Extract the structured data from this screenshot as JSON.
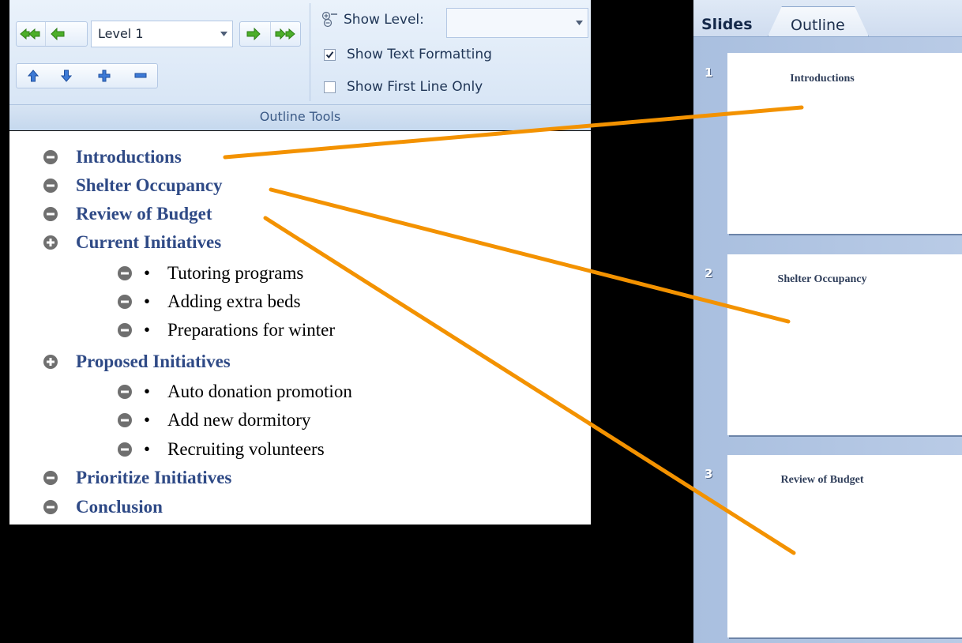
{
  "ribbon": {
    "level_value": "Level 1",
    "show_level_label": "Show Level:",
    "show_level_value": "",
    "show_text_formatting_label": "Show Text Formatting",
    "show_text_formatting_checked": true,
    "show_first_line_label": "Show First Line Only",
    "show_first_line_checked": false,
    "group_label": "Outline Tools",
    "icons": [
      "promote-to-heading-icon",
      "promote-icon",
      "demote-icon",
      "demote-to-body-icon",
      "move-up-icon",
      "move-down-icon",
      "expand-icon",
      "collapse-icon",
      "show-level-icon"
    ]
  },
  "outline": {
    "items": [
      {
        "level": 1,
        "text": "Introductions",
        "symbol": "minus"
      },
      {
        "level": 1,
        "text": "Shelter Occupancy",
        "symbol": "minus"
      },
      {
        "level": 1,
        "text": "Review of Budget",
        "symbol": "minus"
      },
      {
        "level": 1,
        "text": "Current Initiatives",
        "symbol": "plus"
      },
      {
        "level": 2,
        "text": "Tutoring programs",
        "symbol": "minus"
      },
      {
        "level": 2,
        "text": "Adding extra beds",
        "symbol": "minus"
      },
      {
        "level": 2,
        "text": "Preparations for winter",
        "symbol": "minus"
      },
      {
        "level": 1,
        "text": "Proposed Initiatives",
        "symbol": "plus"
      },
      {
        "level": 2,
        "text": "Auto donation promotion",
        "symbol": "minus"
      },
      {
        "level": 2,
        "text": "Add new dormitory",
        "symbol": "minus"
      },
      {
        "level": 2,
        "text": "Recruiting volunteers",
        "symbol": "minus"
      },
      {
        "level": 1,
        "text": "Prioritize Initiatives",
        "symbol": "minus"
      },
      {
        "level": 1,
        "text": "Conclusion",
        "symbol": "minus"
      }
    ],
    "bullet": "•"
  },
  "slides_panel": {
    "tabs": [
      "Slides",
      "Outline"
    ],
    "active_tab": "Slides",
    "slides": [
      {
        "number": "1",
        "title": "Introductions"
      },
      {
        "number": "2",
        "title": "Shelter Occupancy"
      },
      {
        "number": "3",
        "title": "Review of Budget"
      }
    ]
  },
  "colors": {
    "heading_text": "#2f4a86",
    "connector": "#f39200",
    "background": "#000000"
  }
}
